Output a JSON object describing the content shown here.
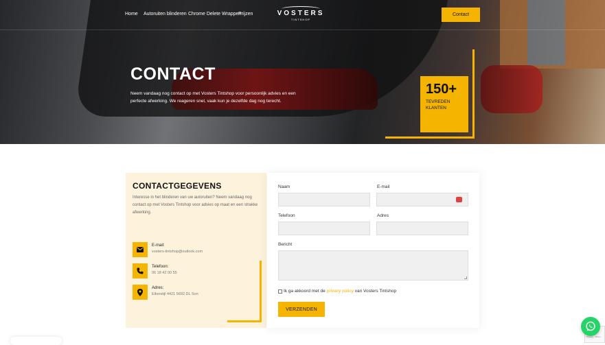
{
  "nav": {
    "links": [
      "Home",
      "Autoruiten blinderen",
      "Chrome Delete Wrappen",
      "Prijzen"
    ],
    "logo_name": "VOSTERS",
    "logo_sub": "TINTSHOP",
    "contact_label": "Contact"
  },
  "hero": {
    "title": "CONTACT",
    "text": "Neem vandaag nog contact op met Vosters Tintshop voor persoonlijk advies en een perfecte afwerking. We reageren snel, vaak kun je dezelfde dag nog terecht.",
    "stat_value": "150+",
    "stat_label_1": "TEVREDEN",
    "stat_label_2": "KLANTEN"
  },
  "contact_info": {
    "heading": "CONTACTGEGEVENS",
    "intro": "Interesse in het blinderen van uw autoruiten? Neem vandaag nog contact op met Vosters Tintshop voor advies op maat en een strakke afwerking.",
    "items": [
      {
        "label": "E-mail:",
        "value": "vosters-tintshop@outlook.com",
        "icon": "envelope-icon"
      },
      {
        "label": "Telefoon:",
        "value": "06 18 42 00 55",
        "icon": "phone-icon"
      },
      {
        "label": "Adres:",
        "value": "Elkerstijl 4421 5692 DL Son",
        "icon": "map-pin-icon"
      }
    ]
  },
  "form": {
    "name_label": "Naam",
    "email_label": "E-mail",
    "phone_label": "Telefoon",
    "address_label": "Adres",
    "message_label": "Bericht",
    "consent_pre": "Ik ga akkoord met de",
    "consent_link": "privacy policy",
    "consent_post": "van Vosters Tintshop",
    "submit_label": "VERZENDEN"
  },
  "recaptcha_text": "Privacy - Terms",
  "colors": {
    "accent": "#f5b400",
    "info_bg": "#fdf3dc",
    "whatsapp": "#25d366"
  }
}
